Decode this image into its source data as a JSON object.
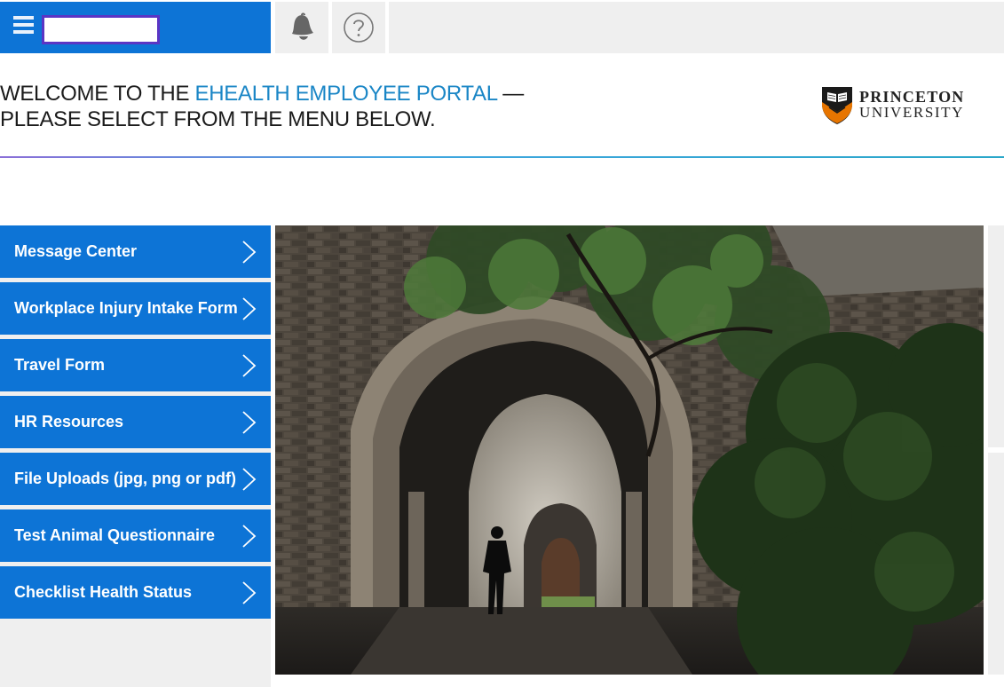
{
  "topbar": {
    "menu_icon": "hamburger-menu-icon",
    "name_input_value": "",
    "notifications_icon": "bell-icon",
    "help_icon": "question-circle-icon"
  },
  "header": {
    "welcome_prefix": "WELCOME TO THE ",
    "portal_name": "EHEALTH EMPLOYEE PORTAL",
    "welcome_dash": " —",
    "welcome_line2": "PLEASE SELECT FROM THE MENU BELOW.",
    "logo_line1": "PRINCETON",
    "logo_line2": "UNIVERSITY"
  },
  "menu": {
    "items": [
      {
        "label": "Message Center"
      },
      {
        "label": "Workplace Injury Intake Form"
      },
      {
        "label": "Travel Form"
      },
      {
        "label": "HR Resources"
      },
      {
        "label": "File Uploads (jpg, png or pdf)"
      },
      {
        "label": "Test Animal Questionnaire"
      },
      {
        "label": "Checklist Health Status"
      }
    ],
    "chevron_icon": "chevron-right-icon"
  },
  "colors": {
    "brand_blue": "#0d74d6",
    "accent_text": "#1a86c6",
    "toolbar_gray": "#efefef",
    "princeton_orange": "#e77500"
  },
  "hero_image": "campus-archway-photo"
}
